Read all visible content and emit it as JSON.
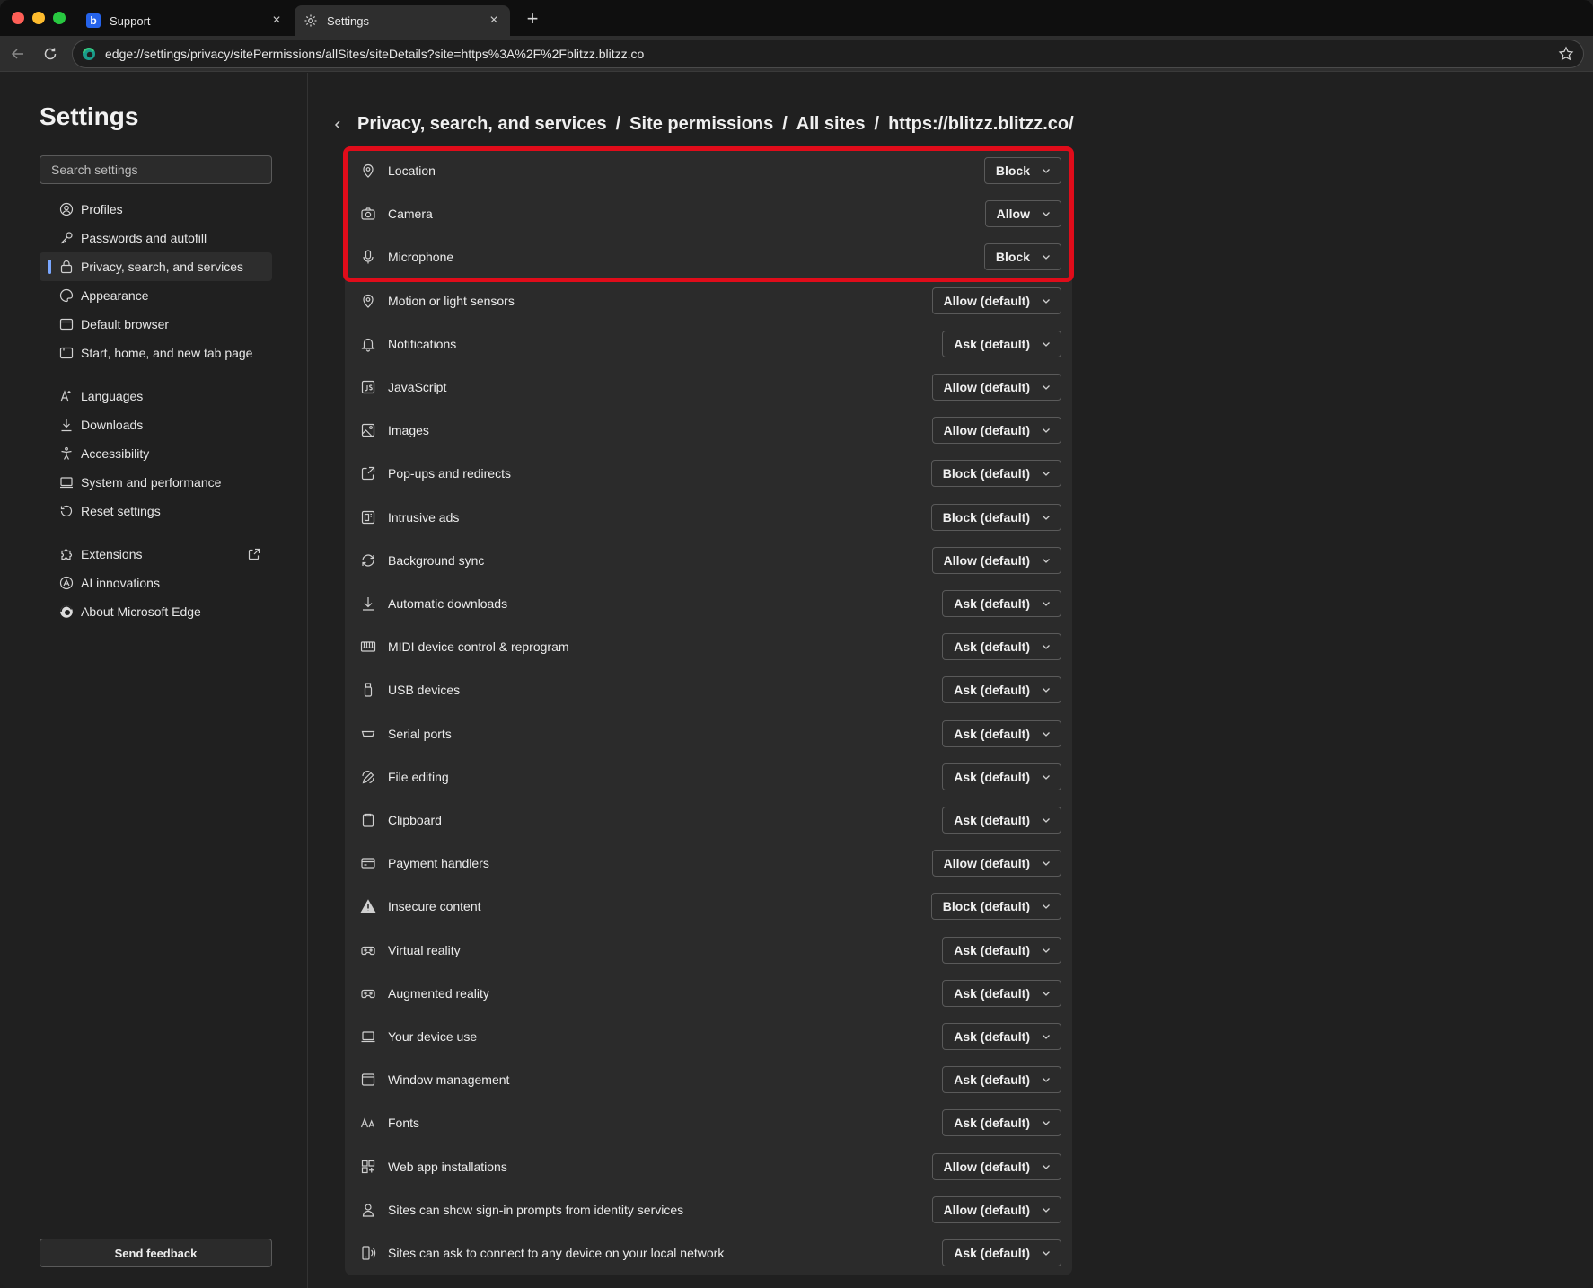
{
  "tabs": [
    {
      "title": "Support",
      "icon": "b-logo-icon"
    },
    {
      "title": "Settings",
      "icon": "gear-icon"
    }
  ],
  "address_bar": {
    "url": "edge://settings/privacy/sitePermissions/allSites/siteDetails?site=https%3A%2F%2Fblitzz.blitzz.co"
  },
  "sidebar": {
    "title": "Settings",
    "search_placeholder": "Search settings",
    "items": [
      {
        "label": "Profiles",
        "icon": "profile-icon"
      },
      {
        "label": "Passwords and autofill",
        "icon": "key-icon"
      },
      {
        "label": "Privacy, search, and services",
        "icon": "lock-icon",
        "active": true
      },
      {
        "label": "Appearance",
        "icon": "palette-icon"
      },
      {
        "label": "Default browser",
        "icon": "browser-icon"
      },
      {
        "label": "Start, home, and new tab page",
        "icon": "home-icon"
      },
      {
        "label": "Languages",
        "icon": "languages-icon"
      },
      {
        "label": "Downloads",
        "icon": "download-icon"
      },
      {
        "label": "Accessibility",
        "icon": "accessibility-icon"
      },
      {
        "label": "System and performance",
        "icon": "laptop-icon"
      },
      {
        "label": "Reset settings",
        "icon": "reset-icon"
      },
      {
        "label": "Extensions",
        "icon": "extensions-icon"
      },
      {
        "label": "AI innovations",
        "icon": "ai-icon"
      },
      {
        "label": "About Microsoft Edge",
        "icon": "edge-icon"
      }
    ],
    "feedback_label": "Send feedback"
  },
  "breadcrumb": {
    "items": [
      "Privacy, search, and services",
      "Site permissions",
      "All sites",
      "https://blitzz.blitzz.co/"
    ],
    "separator": "/"
  },
  "permissions": [
    {
      "label": "Location",
      "value": "Block",
      "icon": "location-icon"
    },
    {
      "label": "Camera",
      "value": "Allow",
      "icon": "camera-icon"
    },
    {
      "label": "Microphone",
      "value": "Block",
      "icon": "microphone-icon"
    },
    {
      "label": "Motion or light sensors",
      "value": "Allow (default)",
      "icon": "sensor-icon"
    },
    {
      "label": "Notifications",
      "value": "Ask (default)",
      "icon": "bell-icon"
    },
    {
      "label": "JavaScript",
      "value": "Allow (default)",
      "icon": "javascript-icon"
    },
    {
      "label": "Images",
      "value": "Allow (default)",
      "icon": "image-icon"
    },
    {
      "label": "Pop-ups and redirects",
      "value": "Block (default)",
      "icon": "popup-icon"
    },
    {
      "label": "Intrusive ads",
      "value": "Block (default)",
      "icon": "ads-icon"
    },
    {
      "label": "Background sync",
      "value": "Allow (default)",
      "icon": "sync-icon"
    },
    {
      "label": "Automatic downloads",
      "value": "Ask (default)",
      "icon": "download-icon"
    },
    {
      "label": "MIDI device control & reprogram",
      "value": "Ask (default)",
      "icon": "midi-icon"
    },
    {
      "label": "USB devices",
      "value": "Ask (default)",
      "icon": "usb-icon"
    },
    {
      "label": "Serial ports",
      "value": "Ask (default)",
      "icon": "serial-icon"
    },
    {
      "label": "File editing",
      "value": "Ask (default)",
      "icon": "file-edit-icon"
    },
    {
      "label": "Clipboard",
      "value": "Ask (default)",
      "icon": "clipboard-icon"
    },
    {
      "label": "Payment handlers",
      "value": "Allow (default)",
      "icon": "payment-icon"
    },
    {
      "label": "Insecure content",
      "value": "Block (default)",
      "icon": "warning-icon"
    },
    {
      "label": "Virtual reality",
      "value": "Ask (default)",
      "icon": "vr-icon"
    },
    {
      "label": "Augmented reality",
      "value": "Ask (default)",
      "icon": "ar-icon"
    },
    {
      "label": "Your device use",
      "value": "Ask (default)",
      "icon": "device-icon"
    },
    {
      "label": "Window management",
      "value": "Ask (default)",
      "icon": "window-icon"
    },
    {
      "label": "Fonts",
      "value": "Ask (default)",
      "icon": "fonts-icon"
    },
    {
      "label": "Web app installations",
      "value": "Allow (default)",
      "icon": "apps-icon"
    },
    {
      "label": "Sites can show sign-in prompts from identity services",
      "value": "Allow (default)",
      "icon": "identity-icon"
    },
    {
      "label": "Sites can ask to connect to any device on your local network",
      "value": "Ask (default)",
      "icon": "network-icon"
    }
  ],
  "colors": {
    "highlight": "#e00c1a",
    "active_indicator": "#7aa7ff"
  }
}
